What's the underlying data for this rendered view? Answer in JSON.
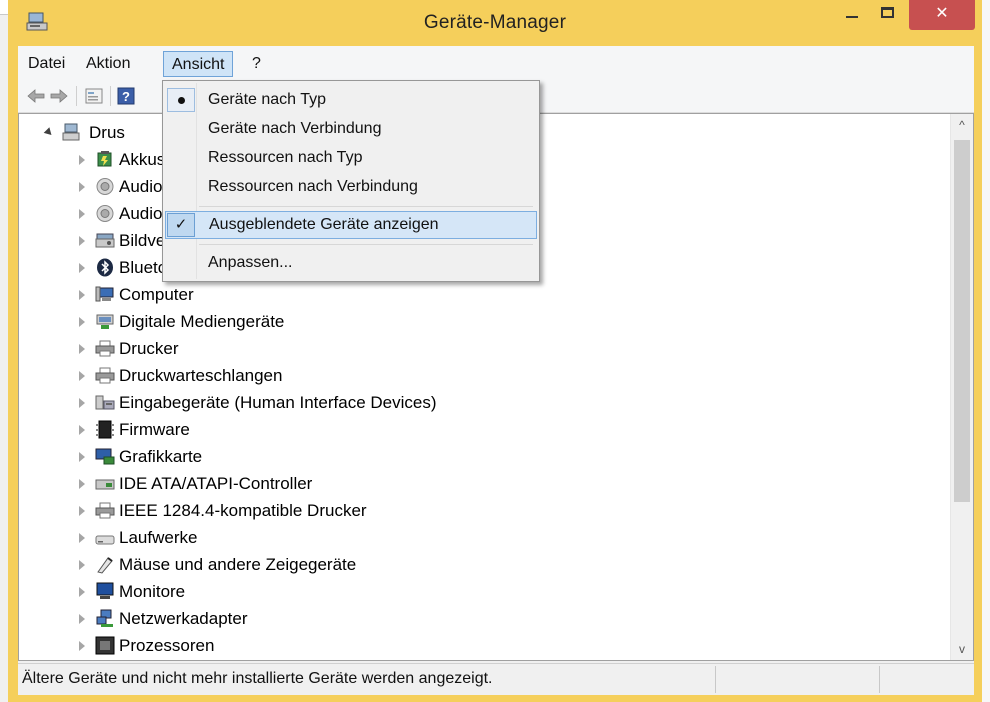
{
  "window": {
    "title": "Geräte-Manager",
    "close_label": "✕"
  },
  "menubar": {
    "items": [
      {
        "label": "Datei"
      },
      {
        "label": "Aktion"
      },
      {
        "label": "Ansicht"
      },
      {
        "label": "?"
      }
    ],
    "open_menu": "Ansicht"
  },
  "toolbar": {
    "icons": [
      "back-arrow-icon",
      "forward-arrow-icon",
      "properties-icon",
      "help-icon"
    ]
  },
  "dropdown": {
    "items": [
      {
        "label": "Geräte nach Typ",
        "mark": "radio"
      },
      {
        "label": "Geräte nach Verbindung",
        "mark": ""
      },
      {
        "label": "Ressourcen nach Typ",
        "mark": ""
      },
      {
        "label": "Ressourcen nach Verbindung",
        "mark": ""
      },
      {
        "label": "Ausgeblendete Geräte anzeigen",
        "mark": "check",
        "highlighted": true
      },
      {
        "label": "Anpassen...",
        "mark": ""
      }
    ]
  },
  "tree": {
    "root": "Drus",
    "categories": [
      "Akkus",
      "Audio",
      "Audio",
      "Bildverarbeitungsgeräte",
      "Bluetooth",
      "Computer",
      "Digitale Mediengeräte",
      "Drucker",
      "Druckwarteschlangen",
      "Eingabegeräte (Human Interface Devices)",
      "Firmware",
      "Grafikkarte",
      "IDE ATA/ATAPI-Controller",
      "IEEE 1284.4-kompatible Drucker",
      "Laufwerke",
      "Mäuse und andere Zeigegeräte",
      "Monitore",
      "Netzwerkadapter",
      "Prozessoren"
    ]
  },
  "scrollbar": {
    "up": "^",
    "down": "v"
  },
  "statusbar": {
    "text": "Ältere Geräte und nicht mehr installierte Geräte werden angezeigt."
  },
  "colors": {
    "frame": "#f5cf5b",
    "close_button": "#c75050",
    "menu_highlight": "#d5e6f7"
  }
}
